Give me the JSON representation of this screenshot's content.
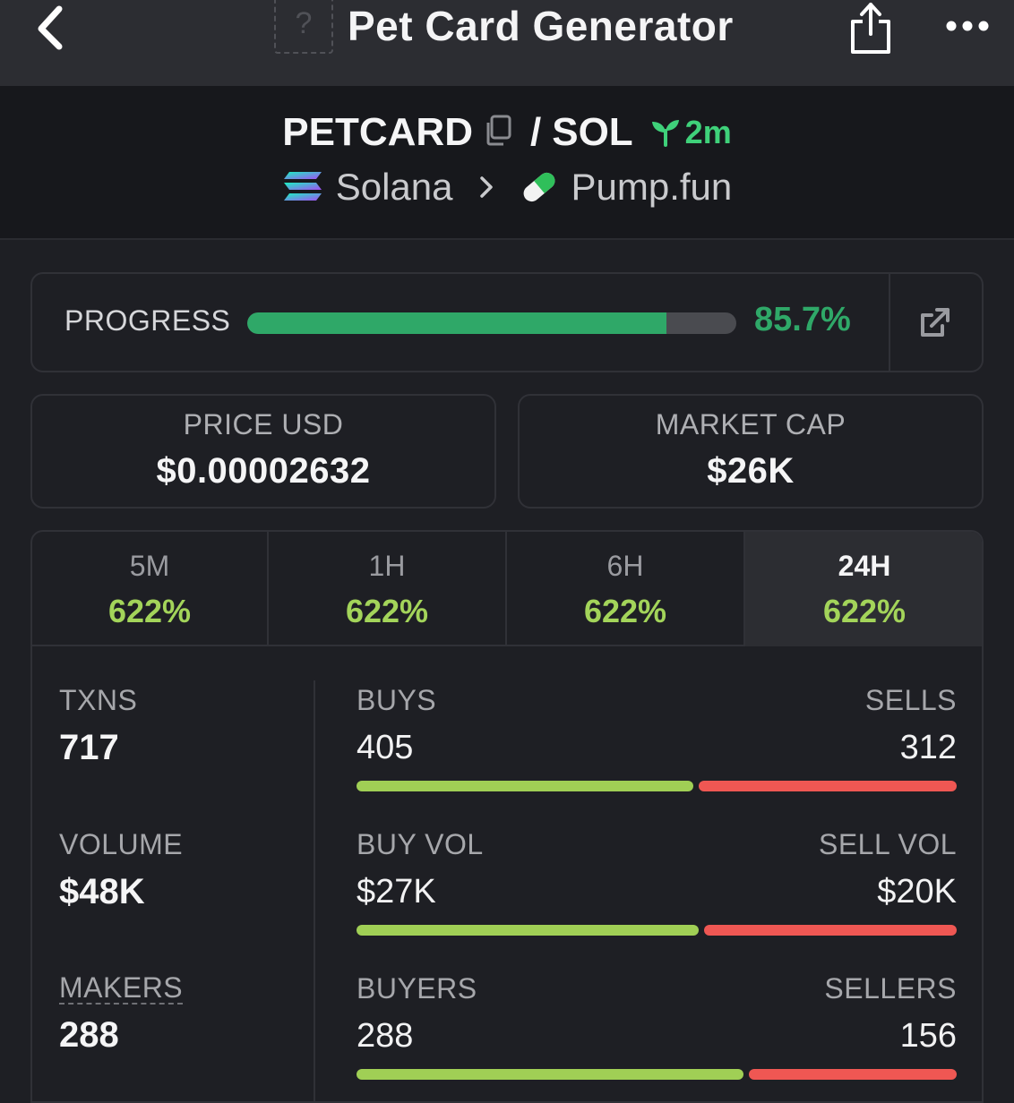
{
  "topbar": {
    "title": "Pet Card Generator",
    "thumb_glyph": "?",
    "icons": [
      "chevron-left-icon",
      "share-icon",
      "more-icon"
    ]
  },
  "pair": {
    "symbol": "PETCARD",
    "separator": "/",
    "quote": "SOL",
    "age": "2m",
    "chain": "Solana",
    "dex": "Pump.fun"
  },
  "progress": {
    "label": "PROGRESS",
    "value_text": "85.7%",
    "fraction": 0.857,
    "color": "#2fa868"
  },
  "price": {
    "label": "PRICE USD",
    "value": "$0.00002632"
  },
  "market_cap": {
    "label": "MARKET CAP",
    "value": "$26K"
  },
  "tabs": [
    {
      "label": "5M",
      "value": "622%"
    },
    {
      "label": "1H",
      "value": "622%"
    },
    {
      "label": "6H",
      "value": "622%"
    },
    {
      "label": "24H",
      "value": "622%"
    }
  ],
  "active_tab": "24H",
  "metrics": {
    "txns": {
      "label": "TXNS",
      "value": "717"
    },
    "volume": {
      "label": "VOLUME",
      "value": "$48K"
    },
    "makers": {
      "label": "MAKERS",
      "value": "288"
    }
  },
  "splits": {
    "txns": {
      "left_label": "BUYS",
      "left_value": "405",
      "right_label": "SELLS",
      "right_value": "312",
      "buy_fraction": 0.565
    },
    "volume": {
      "left_label": "BUY VOL",
      "left_value": "$27K",
      "right_label": "SELL VOL",
      "right_value": "$20K",
      "buy_fraction": 0.574
    },
    "makers": {
      "left_label": "BUYERS",
      "left_value": "288",
      "right_label": "SELLERS",
      "right_value": "156",
      "buy_fraction": 0.649
    }
  },
  "colors": {
    "buy": "#a0cf55",
    "sell": "#ef5753",
    "positive": "#a3d45a",
    "age": "#3fd17a"
  }
}
